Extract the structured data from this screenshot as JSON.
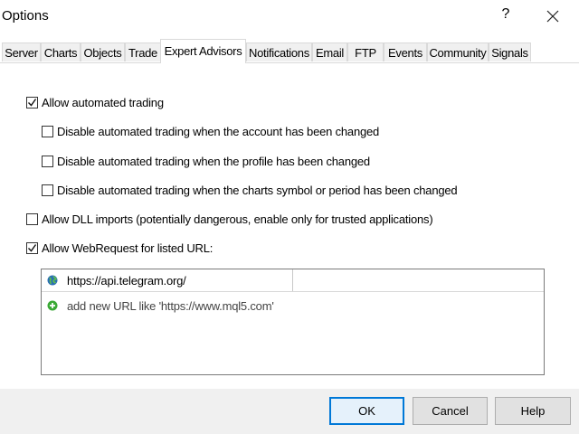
{
  "window": {
    "title": "Options",
    "help_glyph": "?",
    "close_icon": "close-icon"
  },
  "tabs": [
    {
      "label": "Server"
    },
    {
      "label": "Charts"
    },
    {
      "label": "Objects"
    },
    {
      "label": "Trade"
    },
    {
      "label": "Expert Advisors",
      "active": true
    },
    {
      "label": "Notifications"
    },
    {
      "label": "Email"
    },
    {
      "label": "FTP"
    },
    {
      "label": "Events"
    },
    {
      "label": "Community"
    },
    {
      "label": "Signals"
    }
  ],
  "options": {
    "allow_automated_trading": {
      "label": "Allow automated trading",
      "checked": true
    },
    "disable_on_account_change": {
      "label": "Disable automated trading when the account has been changed",
      "checked": false
    },
    "disable_on_profile_change": {
      "label": "Disable automated trading when the profile has been changed",
      "checked": false
    },
    "disable_on_symbol_change": {
      "label": "Disable automated trading when the charts symbol or period has been changed",
      "checked": false
    },
    "allow_dll_imports": {
      "label": "Allow DLL imports (potentially dangerous, enable only for trusted applications)",
      "checked": false
    },
    "allow_webrequest": {
      "label": "Allow WebRequest for listed URL:",
      "checked": true
    }
  },
  "url_list": {
    "items": [
      {
        "url": "https://api.telegram.org/",
        "icon": "globe-icon"
      }
    ],
    "add_placeholder": "add new URL like 'https://www.mql5.com'",
    "add_icon": "add-icon"
  },
  "buttons": {
    "ok": "OK",
    "cancel": "Cancel",
    "help": "Help"
  },
  "colors": {
    "accent": "#0078d7",
    "add_icon": "#3aa935",
    "globe_icon": "#2a6fb5"
  }
}
